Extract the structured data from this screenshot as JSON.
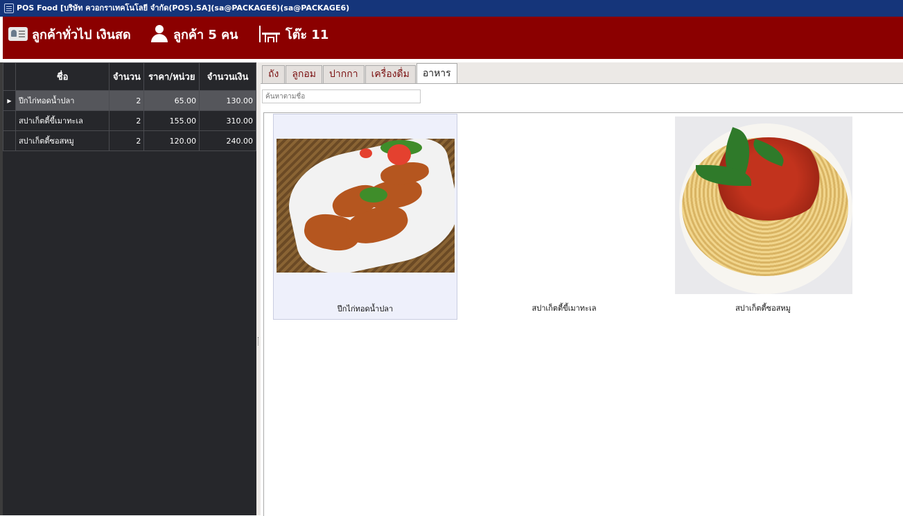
{
  "window": {
    "title": "POS Food [บริษัท ควอกราเทคโนโลยี จำกัด(POS).SA](sa@PACKAGE6)(sa@PACKAGE6)"
  },
  "header": {
    "customer_label": "ลูกค้าทั่วไป เงินสด",
    "guests_label": "ลูกค้า 5 คน",
    "table_label": "โต๊ะ 11",
    "colors": {
      "header_bg": "#8b0000",
      "titlebar_bg": "#15357a"
    }
  },
  "order": {
    "columns": [
      "ชื่อ",
      "จำนวน",
      "ราคา/หน่วย",
      "จำนวนเงิน"
    ],
    "rows": [
      {
        "name": "ปีกไก่ทอดน้ำปลา",
        "qty": "2",
        "price": "65.00",
        "amount": "130.00",
        "selected": true
      },
      {
        "name": "สปาเก็ตตี้ขี้เมาทะเล",
        "qty": "2",
        "price": "155.00",
        "amount": "310.00",
        "selected": false
      },
      {
        "name": "สปาเก็ตตี้ซอสหมู",
        "qty": "2",
        "price": "120.00",
        "amount": "240.00",
        "selected": false
      }
    ]
  },
  "menu": {
    "tabs": [
      "ถัง",
      "ลูกอม",
      "ปากกา",
      "เครื่องดื่ม",
      "อาหาร"
    ],
    "active_tab": "อาหาร",
    "search_placeholder": "ค้นหาตามชื่อ",
    "items": [
      {
        "name": "ปีกไก่ทอดน้ำปลา",
        "icon": "fried-chicken-wings-photo"
      },
      {
        "name": "สปาเก็ตตี้ขี้เมาทะเล",
        "icon": "drunken-seafood-spaghetti-photo"
      },
      {
        "name": "สปาเก็ตตี้ซอสหมู",
        "icon": "pork-sauce-spaghetti-photo"
      }
    ]
  }
}
